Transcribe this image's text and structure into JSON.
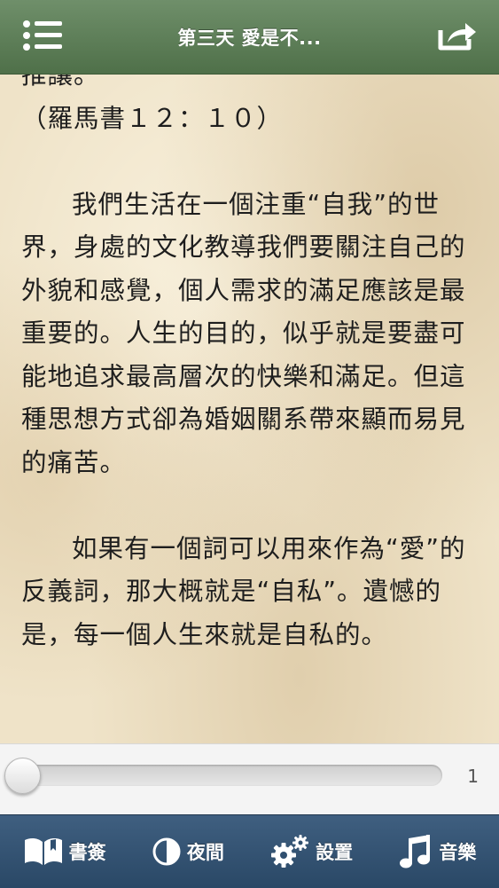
{
  "header": {
    "title": "第三天 愛是不...",
    "menu_icon": "list-menu-icon",
    "share_icon": "share-icon"
  },
  "reader": {
    "lines": [
      "推讓。",
      "（羅馬書１２：１０）"
    ],
    "paragraph1": "我們生活在一個注重“自我”的世界，身處的文化教導我們要關注自己的外貌和感覺，個人需求的滿足應該是最重要的。人生的目的，似乎就是要盡可能地追求最高層次的快樂和滿足。但這種思想方式卻為婚姻關系帶來顯而易見的痛苦。",
    "paragraph2": "如果有一個詞可以用來作為“愛”的反義詞，那大概就是“自私”。遺憾的是，每一個人生來就是自私的。"
  },
  "slider": {
    "value": 0,
    "page_label": "1"
  },
  "toolbar": {
    "bookmark_label": "書簽",
    "night_label": "夜間",
    "settings_label": "設置",
    "music_label": "音樂"
  },
  "colors": {
    "header": "#5a7a54",
    "toolbar": "#34536f",
    "paper": "#efe3c8"
  }
}
